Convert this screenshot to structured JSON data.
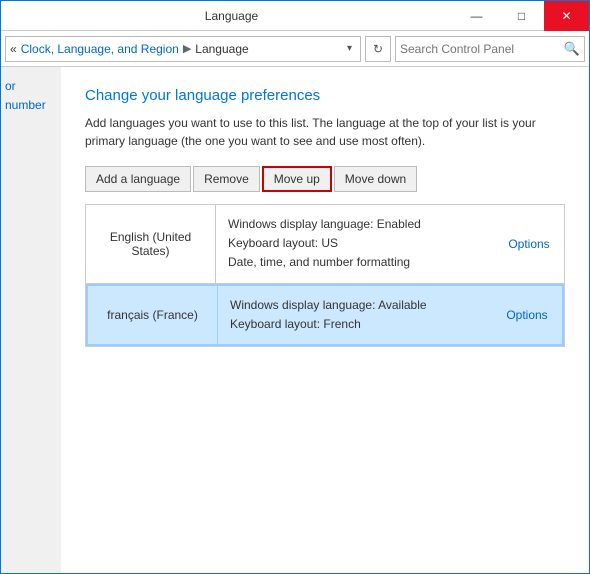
{
  "window": {
    "title": "Language",
    "min_btn": "—",
    "max_btn": "□",
    "close_btn": "✕"
  },
  "addressbar": {
    "nav_text": "«",
    "breadcrumb_parent": "Clock, Language, and Region",
    "breadcrumb_separator": "▶",
    "breadcrumb_current": "Language",
    "dropdown_char": "▾",
    "refresh_char": "↻",
    "search_placeholder": "Search Control Panel",
    "search_icon": "🔍"
  },
  "sidebar": {
    "link_text": "or number"
  },
  "content": {
    "title": "Change your language preferences",
    "description": "Add languages you want to use to this list. The language at the top of your list is your primary language (the one you want to see and use most often).",
    "toolbar": {
      "add_label": "Add a language",
      "remove_label": "Remove",
      "move_up_label": "Move up",
      "move_down_label": "Move down"
    },
    "languages": [
      {
        "name": "English (United States)",
        "info_line1": "Windows display language: Enabled",
        "info_line2": "Keyboard layout: US",
        "info_line3": "Date, time, and number formatting",
        "options_label": "Options",
        "selected": false
      },
      {
        "name": "français (France)",
        "info_line1": "Windows display language: Available",
        "info_line2": "Keyboard layout: French",
        "info_line3": "",
        "options_label": "Options",
        "selected": true
      }
    ]
  }
}
